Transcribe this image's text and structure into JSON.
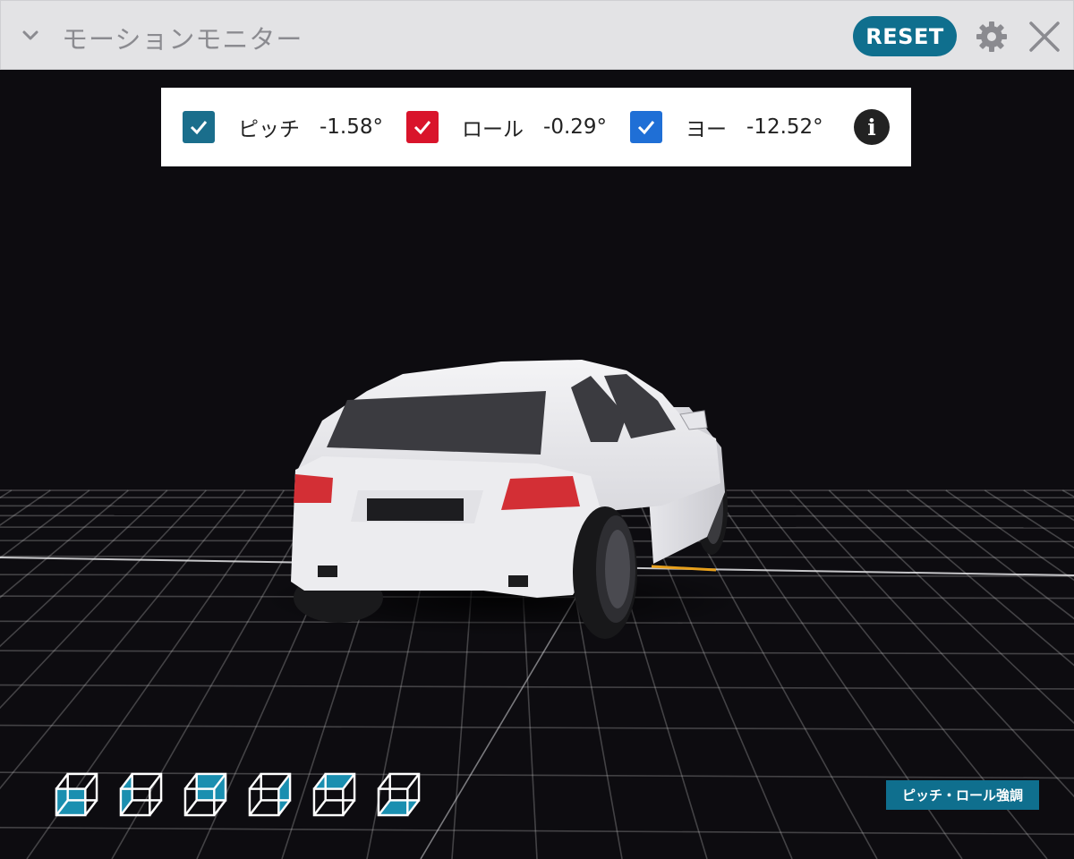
{
  "window": {
    "title": "モーションモニター"
  },
  "toolbar": {
    "reset_label": "RESET"
  },
  "axes": [
    {
      "label": "ピッチ",
      "value": "-1.58°",
      "checked": true,
      "color": "#1a6e8c"
    },
    {
      "label": "ロール",
      "value": "-0.29°",
      "checked": true,
      "color": "#d9142b"
    },
    {
      "label": "ヨー",
      "value": "-12.52°",
      "checked": true,
      "color": "#1f6fd6"
    }
  ],
  "info": {
    "icon": "info-icon",
    "glyph": "i"
  },
  "view_cubes": [
    "cube-view-icon",
    "cube-view-icon",
    "cube-view-icon",
    "cube-view-icon",
    "cube-view-icon",
    "cube-view-icon"
  ],
  "emphasis_label": "ピッチ・ロール強調",
  "theme": {
    "accent": "#0f6f8e",
    "background": "#0d0c10",
    "grid": "#cfcfd2",
    "highlight": "#e8a01c"
  }
}
